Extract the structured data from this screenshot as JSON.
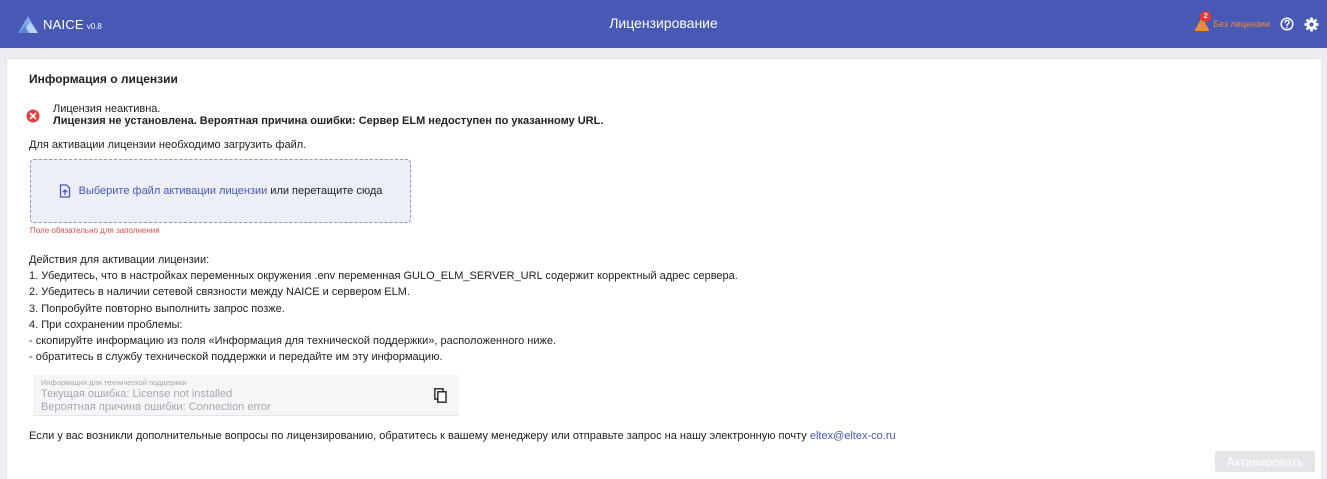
{
  "header": {
    "brand_name": "NAICE",
    "brand_version": "v0.8",
    "title": "Лицензирование",
    "warning_badge": "2",
    "license_status": "Без лицензии",
    "icons": [
      "logo-icon",
      "warning-icon",
      "help-icon",
      "gear-icon"
    ],
    "colors": {
      "bar": "#4858b5",
      "status": "#f08b33",
      "badge": "#e53935"
    }
  },
  "license": {
    "heading": "Информация о лицензии",
    "status_line": "Лицензия неактивна.",
    "reason_line": "Лицензия не установлена. Вероятная причина ошибки: Сервер ELM недоступен по указанному URL.",
    "need_file": "Для активации лицензии необходимо загрузить файл.",
    "dropzone": {
      "choose_link": "Выберите файл активации лицензии",
      "rest": "или перетащите сюда"
    },
    "required_hint": "Поле обязательно для заполнения",
    "steps": [
      "Действия для активации лицензии:",
      "1. Убедитесь, что в настройках переменных окружения .env переменная GULO_ELM_SERVER_URL содержит корректный адрес сервера.",
      "2. Убедитесь в наличии сетевой связности между NAICE и сервером ELM.",
      "3. Попробуйте повторно выполнить запрос позже.",
      "4. При сохранении проблемы:",
      "- скопируйте информацию из поля «Информация для технической поддержки», расположенного ниже.",
      "- обратитесь в службу технической поддержки и передайте им эту информацию."
    ],
    "support": {
      "label": "Информация для технической поддержки",
      "line1": "Текущая ошибка: License not installed",
      "line2": "Вероятная причина ошибки: Connection error"
    },
    "contact_text": "Если у вас возникли дополнительные вопросы по лицензированию, обратитесь к вашему менеджеру или отправьте запрос на нашу электронную почту",
    "contact_email": "eltex@eltex-co.ru",
    "activate_label": "Активировать"
  }
}
